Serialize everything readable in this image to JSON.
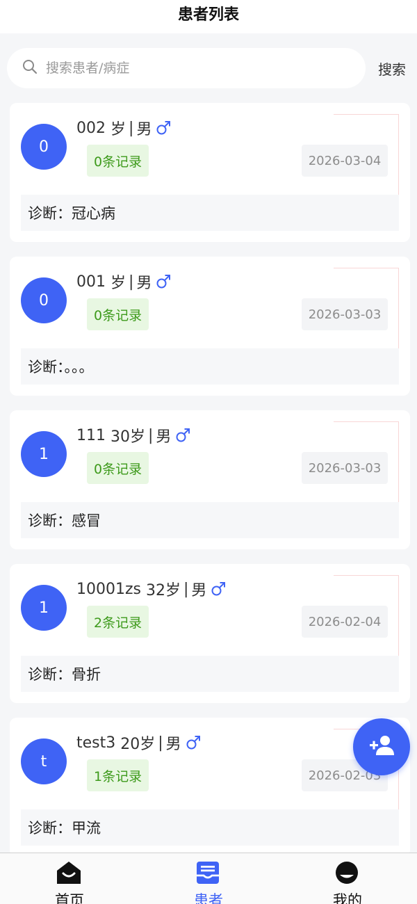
{
  "header": {
    "title": "患者列表"
  },
  "search": {
    "placeholder": "搜索患者/病症",
    "value": "",
    "button_label": "搜索"
  },
  "patients": [
    {
      "avatar": "0",
      "name": "002",
      "age": "岁",
      "sex": "男",
      "records": "0条记录",
      "date": "2026-03-04",
      "diagnosis": "诊断：冠心病"
    },
    {
      "avatar": "0",
      "name": "001",
      "age": "岁",
      "sex": "男",
      "records": "0条记录",
      "date": "2026-03-03",
      "diagnosis": "诊断：。。。"
    },
    {
      "avatar": "1",
      "name": "111",
      "age": "30岁",
      "sex": "男",
      "records": "0条记录",
      "date": "2026-03-03",
      "diagnosis": "诊断：感冒"
    },
    {
      "avatar": "1",
      "name": "10001zs",
      "age": "32岁",
      "sex": "男",
      "records": "2条记录",
      "date": "2026-02-04",
      "diagnosis": "诊断：骨折"
    },
    {
      "avatar": "t",
      "name": "test3",
      "age": "20岁",
      "sex": "男",
      "records": "1条记录",
      "date": "2026-02-03",
      "diagnosis": "诊断：甲流"
    }
  ],
  "fab": {
    "icon": "add-person-icon"
  },
  "tabbar": {
    "items": [
      {
        "label": "首页",
        "icon": "home-icon",
        "active": false
      },
      {
        "label": "患者",
        "icon": "inbox-icon",
        "active": true
      },
      {
        "label": "我的",
        "icon": "profile-icon",
        "active": false
      }
    ]
  },
  "colors": {
    "accent": "#3f63f5",
    "record_text": "#3d9a1b",
    "record_bg": "#e8f7e2",
    "male_icon": "#3f63f5"
  }
}
